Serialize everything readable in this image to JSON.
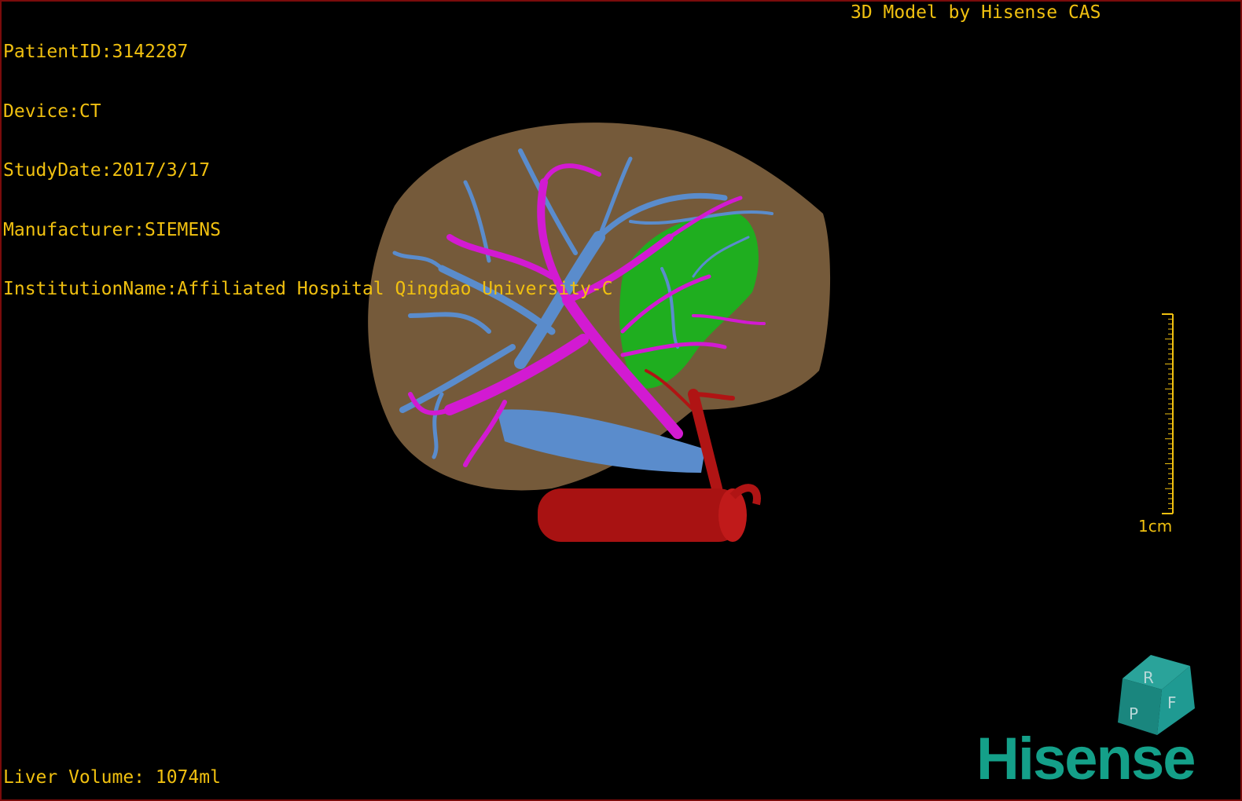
{
  "info": {
    "patient_id": "PatientID:3142287",
    "device": "Device:CT",
    "study_date": "StudyDate:2017/3/17",
    "manufacturer": "Manufacturer:SIEMENS",
    "institution": "InstitutionName:Affiliated Hospital Qingdao University-C"
  },
  "brand_title": "3D Model by Hisense CAS",
  "liver_volume": "Liver Volume: 1074ml",
  "scale": {
    "label": "1cm"
  },
  "orientation_cube": {
    "faces": [
      "R",
      "F",
      "P"
    ]
  },
  "logo": {
    "text": "Hisense",
    "color": "#14a089"
  },
  "colors": {
    "text": "#f0c010",
    "liver": "#8a6a44",
    "portal_vein": "#d21ad2",
    "hepatic_vein": "#5a8ccc",
    "artery_aorta": "#b01414",
    "lesion": "#1fae1f",
    "background": "#000000"
  }
}
